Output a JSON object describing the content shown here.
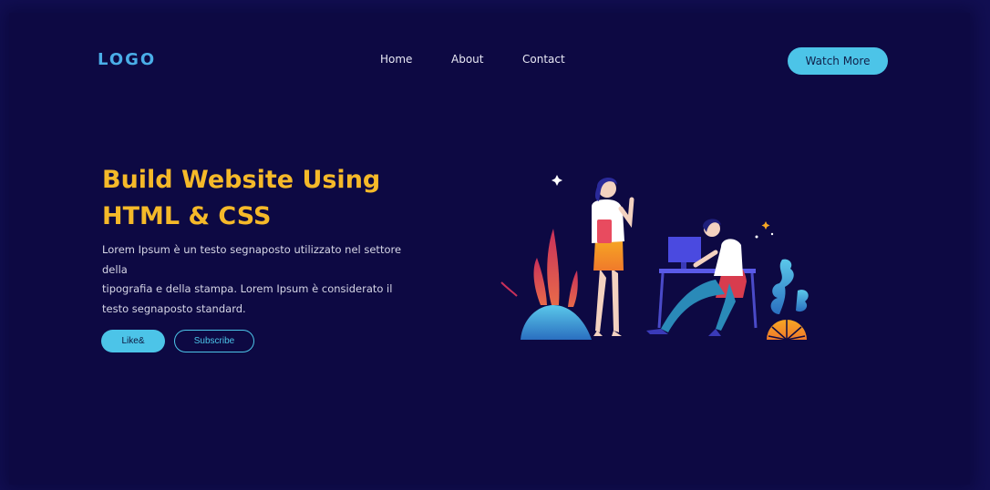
{
  "header": {
    "logo": "LOGO",
    "nav": [
      {
        "label": "Home"
      },
      {
        "label": "About"
      },
      {
        "label": "Contact"
      }
    ],
    "cta_label": "Watch More"
  },
  "hero": {
    "title_line1": "Build Website Using",
    "title_line2": "HTML & CSS",
    "text_line1": "Lorem Ipsum è un testo segnaposto utilizzato nel settore della",
    "text_line2": "tipografia e della stampa. Lorem Ipsum è considerato il",
    "text_line3": "testo segnaposto standard.",
    "like_label": "Like&",
    "subscribe_label": "Subscribe"
  },
  "colors": {
    "background": "#0d0943",
    "accent": "#4cc4e8",
    "title": "#f5b929"
  },
  "illustration": {
    "description_icon": "office-people-illustration"
  }
}
